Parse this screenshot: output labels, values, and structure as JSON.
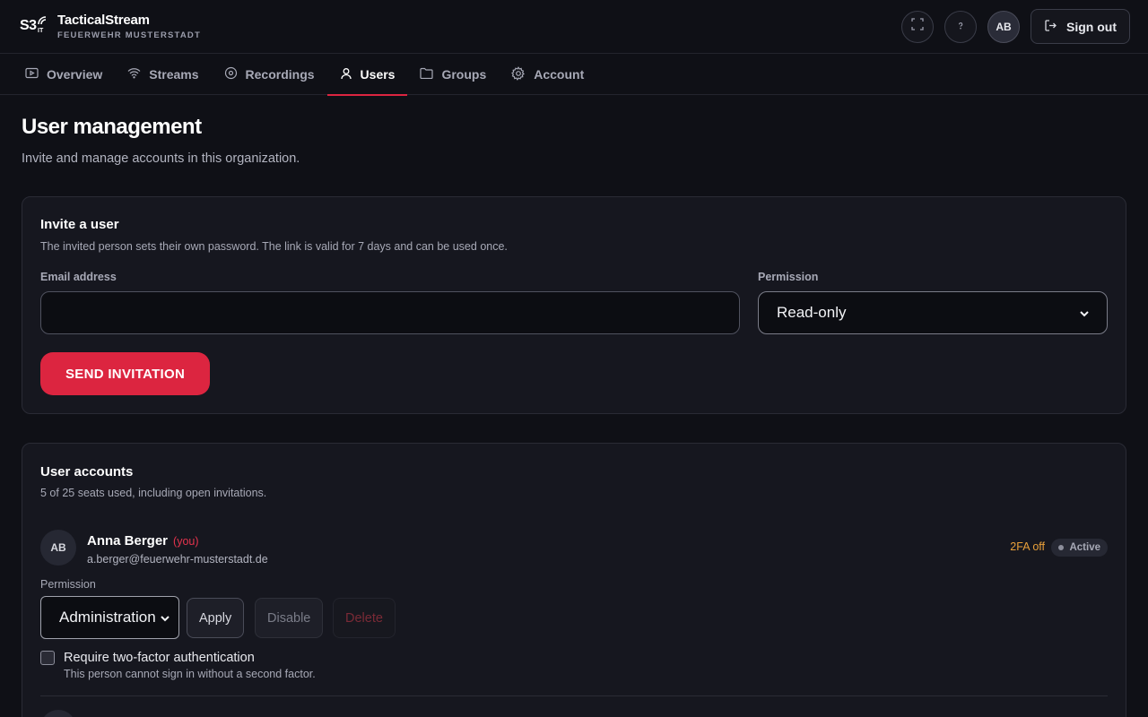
{
  "app": {
    "name": "TacticalStream",
    "org": "FEUERWEHR MUSTERSTADT",
    "logo_text": "S3IT"
  },
  "header": {
    "avatar_initials": "AB",
    "sign_out_label": "Sign out",
    "icons": [
      "fullscreen-icon",
      "help-icon",
      "sign-out-icon"
    ]
  },
  "tabs": [
    {
      "label": "Overview",
      "icon": "play-icon"
    },
    {
      "label": "Streams",
      "icon": "wifi-icon"
    },
    {
      "label": "Recordings",
      "icon": "record-icon"
    },
    {
      "label": "Users",
      "icon": "user-icon",
      "active": true
    },
    {
      "label": "Groups",
      "icon": "folder-icon"
    },
    {
      "label": "Account",
      "icon": "gear-icon"
    }
  ],
  "page": {
    "title": "User management",
    "subtitle": "Invite and manage accounts in this organization."
  },
  "invite": {
    "title": "Invite a user",
    "description": "The invited person sets their own password. The link is valid for 7 days and can be used once.",
    "email_label": "Email address",
    "email_value": "",
    "permission_label": "Permission",
    "permission_value": "Read-only",
    "send_label": "SEND INVITATION"
  },
  "accounts": {
    "title": "User accounts",
    "seats_text": "5 of 25 seats used, including open invitations.",
    "users": [
      {
        "initials": "AB",
        "name": "Anna Berger",
        "you_label": "(you)",
        "email": "a.berger@feuerwehr-musterstadt.de",
        "twofa_status": "2FA off",
        "status": "Active",
        "permission_label": "Permission",
        "permission_value": "Administration",
        "apply_label": "Apply",
        "disable_label": "Disable",
        "delete_label": "Delete",
        "require_2fa_label": "Require two-factor authentication",
        "require_2fa_hint": "This person cannot sign in without a second factor.",
        "require_2fa_checked": false
      }
    ]
  },
  "colors": {
    "accent": "#dc2540",
    "background": "#0f1016",
    "card": "#16171f",
    "warning": "#e9a03a"
  }
}
